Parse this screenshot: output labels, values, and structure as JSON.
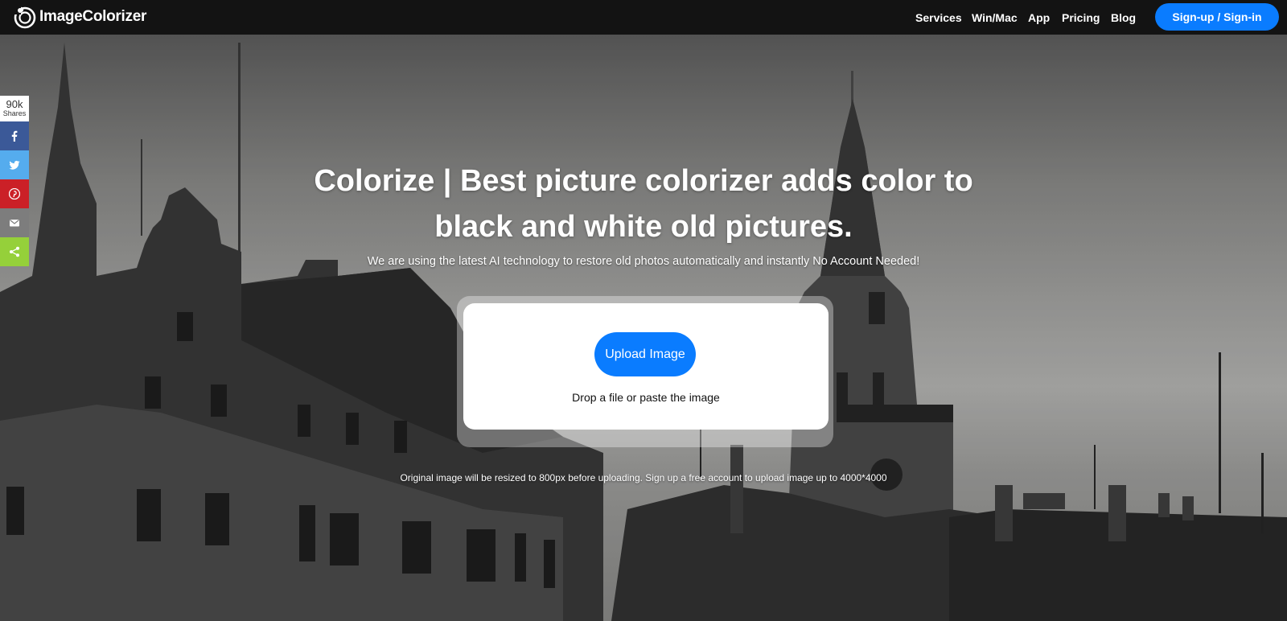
{
  "brand": {
    "name": "ImageColorizer"
  },
  "nav": {
    "items": [
      "Services",
      "Win/Mac",
      "App",
      "Pricing",
      "Blog"
    ],
    "signin_label": "Sign-up / Sign-in",
    "signin_color": "#0a7cff"
  },
  "share": {
    "count": "90k",
    "count_label": "Shares",
    "buttons": [
      {
        "icon": "facebook-icon",
        "color": "#3b5998"
      },
      {
        "icon": "twitter-icon",
        "color": "#55acee"
      },
      {
        "icon": "pinterest-icon",
        "color": "#cb2027"
      },
      {
        "icon": "email-icon",
        "color": "#7d7d7d"
      },
      {
        "icon": "share-icon",
        "color": "#95d03a"
      }
    ]
  },
  "hero": {
    "title": "Colorize | Best picture colorizer adds color to black and white old pictures.",
    "subtitle": "We are using the latest AI technology to restore old photos automatically and instantly No Account Needed!",
    "upload_label": "Upload Image",
    "drop_text": "Drop a file or paste the image",
    "note": "Original image will be resized to 800px before uploading. Sign up a free account to upload image up to 4000*4000"
  }
}
